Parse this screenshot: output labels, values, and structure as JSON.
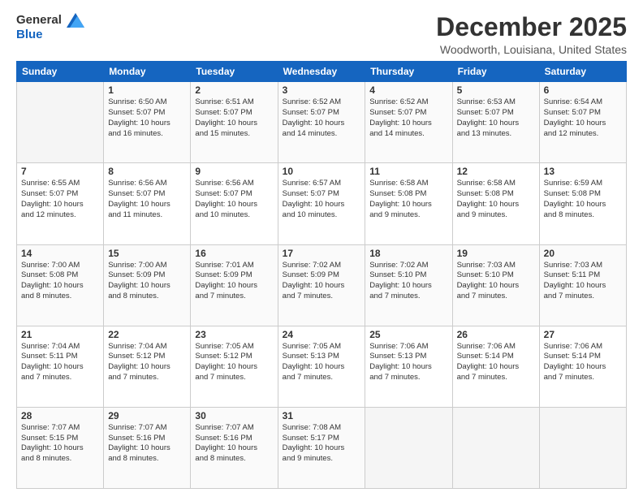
{
  "logo": {
    "line1": "General",
    "line2": "Blue"
  },
  "title": "December 2025",
  "location": "Woodworth, Louisiana, United States",
  "header_days": [
    "Sunday",
    "Monday",
    "Tuesday",
    "Wednesday",
    "Thursday",
    "Friday",
    "Saturday"
  ],
  "weeks": [
    [
      {
        "day": "",
        "lines": []
      },
      {
        "day": "1",
        "lines": [
          "Sunrise: 6:50 AM",
          "Sunset: 5:07 PM",
          "Daylight: 10 hours",
          "and 16 minutes."
        ]
      },
      {
        "day": "2",
        "lines": [
          "Sunrise: 6:51 AM",
          "Sunset: 5:07 PM",
          "Daylight: 10 hours",
          "and 15 minutes."
        ]
      },
      {
        "day": "3",
        "lines": [
          "Sunrise: 6:52 AM",
          "Sunset: 5:07 PM",
          "Daylight: 10 hours",
          "and 14 minutes."
        ]
      },
      {
        "day": "4",
        "lines": [
          "Sunrise: 6:52 AM",
          "Sunset: 5:07 PM",
          "Daylight: 10 hours",
          "and 14 minutes."
        ]
      },
      {
        "day": "5",
        "lines": [
          "Sunrise: 6:53 AM",
          "Sunset: 5:07 PM",
          "Daylight: 10 hours",
          "and 13 minutes."
        ]
      },
      {
        "day": "6",
        "lines": [
          "Sunrise: 6:54 AM",
          "Sunset: 5:07 PM",
          "Daylight: 10 hours",
          "and 12 minutes."
        ]
      }
    ],
    [
      {
        "day": "7",
        "lines": [
          "Sunrise: 6:55 AM",
          "Sunset: 5:07 PM",
          "Daylight: 10 hours",
          "and 12 minutes."
        ]
      },
      {
        "day": "8",
        "lines": [
          "Sunrise: 6:56 AM",
          "Sunset: 5:07 PM",
          "Daylight: 10 hours",
          "and 11 minutes."
        ]
      },
      {
        "day": "9",
        "lines": [
          "Sunrise: 6:56 AM",
          "Sunset: 5:07 PM",
          "Daylight: 10 hours",
          "and 10 minutes."
        ]
      },
      {
        "day": "10",
        "lines": [
          "Sunrise: 6:57 AM",
          "Sunset: 5:07 PM",
          "Daylight: 10 hours",
          "and 10 minutes."
        ]
      },
      {
        "day": "11",
        "lines": [
          "Sunrise: 6:58 AM",
          "Sunset: 5:08 PM",
          "Daylight: 10 hours",
          "and 9 minutes."
        ]
      },
      {
        "day": "12",
        "lines": [
          "Sunrise: 6:58 AM",
          "Sunset: 5:08 PM",
          "Daylight: 10 hours",
          "and 9 minutes."
        ]
      },
      {
        "day": "13",
        "lines": [
          "Sunrise: 6:59 AM",
          "Sunset: 5:08 PM",
          "Daylight: 10 hours",
          "and 8 minutes."
        ]
      }
    ],
    [
      {
        "day": "14",
        "lines": [
          "Sunrise: 7:00 AM",
          "Sunset: 5:08 PM",
          "Daylight: 10 hours",
          "and 8 minutes."
        ]
      },
      {
        "day": "15",
        "lines": [
          "Sunrise: 7:00 AM",
          "Sunset: 5:09 PM",
          "Daylight: 10 hours",
          "and 8 minutes."
        ]
      },
      {
        "day": "16",
        "lines": [
          "Sunrise: 7:01 AM",
          "Sunset: 5:09 PM",
          "Daylight: 10 hours",
          "and 7 minutes."
        ]
      },
      {
        "day": "17",
        "lines": [
          "Sunrise: 7:02 AM",
          "Sunset: 5:09 PM",
          "Daylight: 10 hours",
          "and 7 minutes."
        ]
      },
      {
        "day": "18",
        "lines": [
          "Sunrise: 7:02 AM",
          "Sunset: 5:10 PM",
          "Daylight: 10 hours",
          "and 7 minutes."
        ]
      },
      {
        "day": "19",
        "lines": [
          "Sunrise: 7:03 AM",
          "Sunset: 5:10 PM",
          "Daylight: 10 hours",
          "and 7 minutes."
        ]
      },
      {
        "day": "20",
        "lines": [
          "Sunrise: 7:03 AM",
          "Sunset: 5:11 PM",
          "Daylight: 10 hours",
          "and 7 minutes."
        ]
      }
    ],
    [
      {
        "day": "21",
        "lines": [
          "Sunrise: 7:04 AM",
          "Sunset: 5:11 PM",
          "Daylight: 10 hours",
          "and 7 minutes."
        ]
      },
      {
        "day": "22",
        "lines": [
          "Sunrise: 7:04 AM",
          "Sunset: 5:12 PM",
          "Daylight: 10 hours",
          "and 7 minutes."
        ]
      },
      {
        "day": "23",
        "lines": [
          "Sunrise: 7:05 AM",
          "Sunset: 5:12 PM",
          "Daylight: 10 hours",
          "and 7 minutes."
        ]
      },
      {
        "day": "24",
        "lines": [
          "Sunrise: 7:05 AM",
          "Sunset: 5:13 PM",
          "Daylight: 10 hours",
          "and 7 minutes."
        ]
      },
      {
        "day": "25",
        "lines": [
          "Sunrise: 7:06 AM",
          "Sunset: 5:13 PM",
          "Daylight: 10 hours",
          "and 7 minutes."
        ]
      },
      {
        "day": "26",
        "lines": [
          "Sunrise: 7:06 AM",
          "Sunset: 5:14 PM",
          "Daylight: 10 hours",
          "and 7 minutes."
        ]
      },
      {
        "day": "27",
        "lines": [
          "Sunrise: 7:06 AM",
          "Sunset: 5:14 PM",
          "Daylight: 10 hours",
          "and 7 minutes."
        ]
      }
    ],
    [
      {
        "day": "28",
        "lines": [
          "Sunrise: 7:07 AM",
          "Sunset: 5:15 PM",
          "Daylight: 10 hours",
          "and 8 minutes."
        ]
      },
      {
        "day": "29",
        "lines": [
          "Sunrise: 7:07 AM",
          "Sunset: 5:16 PM",
          "Daylight: 10 hours",
          "and 8 minutes."
        ]
      },
      {
        "day": "30",
        "lines": [
          "Sunrise: 7:07 AM",
          "Sunset: 5:16 PM",
          "Daylight: 10 hours",
          "and 8 minutes."
        ]
      },
      {
        "day": "31",
        "lines": [
          "Sunrise: 7:08 AM",
          "Sunset: 5:17 PM",
          "Daylight: 10 hours",
          "and 9 minutes."
        ]
      },
      {
        "day": "",
        "lines": []
      },
      {
        "day": "",
        "lines": []
      },
      {
        "day": "",
        "lines": []
      }
    ]
  ]
}
